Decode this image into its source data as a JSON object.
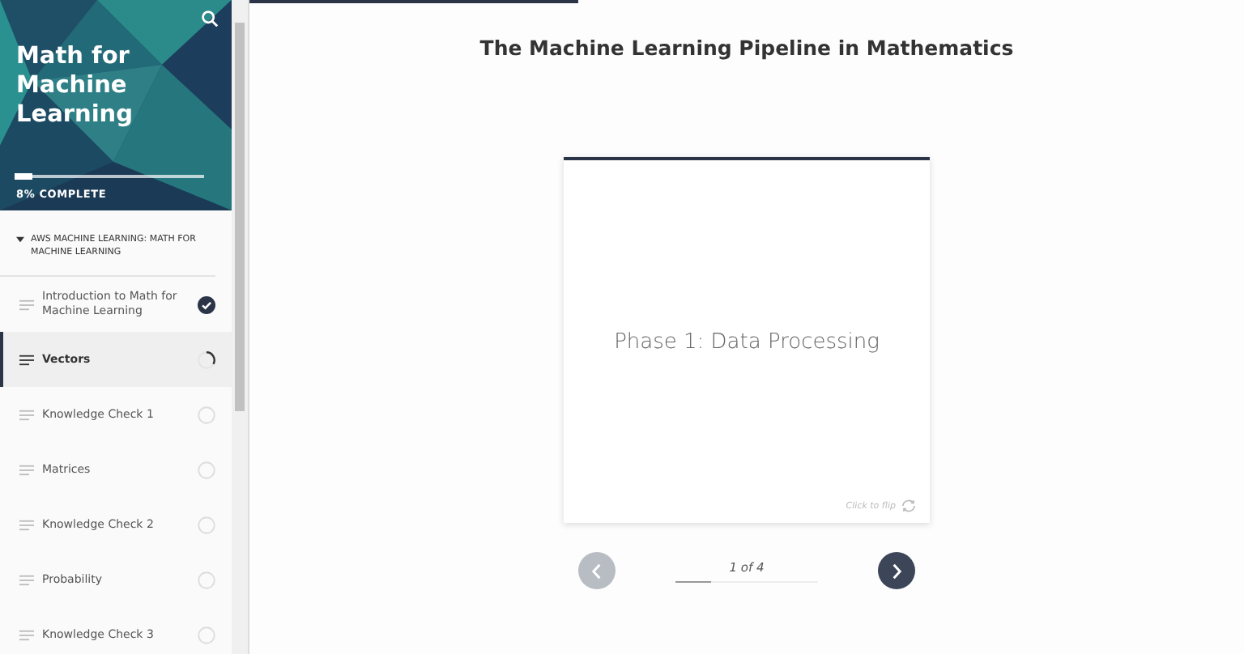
{
  "sidebar": {
    "course_title": "Math for Machine Learning",
    "progress": {
      "level": 0.08,
      "label": "8% COMPLETE"
    },
    "section": {
      "title": "AWS MACHINE LEARNING: MATH FOR MACHINE LEARNING",
      "expanded": true
    },
    "lessons": [
      {
        "title": "Introduction to Math for Machine Learning",
        "selected": false,
        "kind": "complete"
      },
      {
        "title": "Vectors",
        "selected": true,
        "kind": "started"
      },
      {
        "title": "Knowledge Check 1",
        "selected": false,
        "kind": "pending"
      },
      {
        "title": "Matrices",
        "selected": false,
        "kind": "pending"
      },
      {
        "title": "Knowledge Check 2",
        "selected": false,
        "kind": "pending"
      },
      {
        "title": "Probability",
        "selected": false,
        "kind": "pending"
      },
      {
        "title": "Knowledge Check 3",
        "selected": false,
        "kind": "pending"
      }
    ]
  },
  "lesson_progress": {
    "level": 0.33
  },
  "main": {
    "title": "The Machine Learning Pipeline in Mathematics",
    "card": {
      "text": "Phase 1: Data Processing",
      "flip_hint": "Click to flip"
    },
    "pager": {
      "label": "1 of 4",
      "level": 0.25,
      "prev_disabled": true,
      "next_disabled": false
    }
  }
}
